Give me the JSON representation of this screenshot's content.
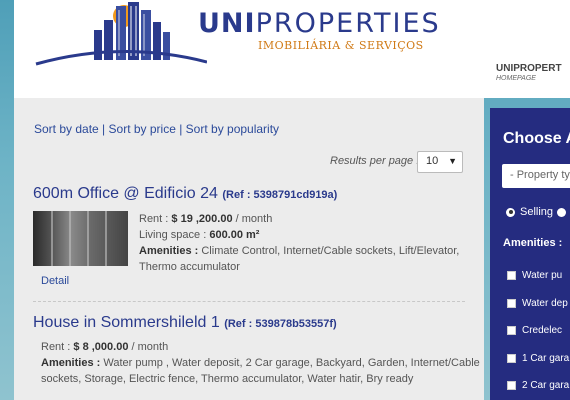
{
  "brand": {
    "name_bold": "UNI",
    "name_light": "PROPERTIES",
    "tagline": "IMOBILIÁRIA & SERVIÇOS",
    "colors": {
      "primary": "#2a3a8c",
      "accent": "#d07a16",
      "sun": "#f29a1d"
    }
  },
  "top_nav": {
    "label": "UNIPROPERT",
    "sublabel": "HOMEPAGE"
  },
  "sort": {
    "by_date": "Sort by date",
    "sep1": " | ",
    "by_price": "Sort by price",
    "sep2": " | ",
    "by_popularity": "Sort by popularity"
  },
  "results_per_page": {
    "label": "Results per page :",
    "value": "10"
  },
  "listings": [
    {
      "title": "600m Office @ Edificio 24 ",
      "ref_label": "(Ref : 5398791cd919a)",
      "rent_label": "Rent : ",
      "rent_value": "$ 19 ,200.00",
      "rent_unit": " / month",
      "space_label": "Living space : ",
      "space_value": "600.00 m²",
      "amenities_label": "Amenities : ",
      "amenities": "Climate Control, Internet/Cable sockets, Lift/Elevator, Thermo accumulator",
      "detail_link": "Detail"
    },
    {
      "title": "House in Sommershileld 1 ",
      "ref_label": "(Ref : 539878b53557f)",
      "rent_label": "Rent : ",
      "rent_value": "$ 8 ,000.00",
      "rent_unit": " / month",
      "amenities_label": "Amenities : ",
      "amenities": "Water pump , Water deposit, 2 Car garage, Backyard, Garden, Internet/Cable sockets, Storage, Electric fence, Thermo accumulator, Water hatir, Bry ready"
    }
  ],
  "filter": {
    "title": "Choose A",
    "property_type_placeholder": "- Property ty",
    "mode_selected": "Selling",
    "amenities_label": "Amenities :",
    "amenities": [
      "Water pu",
      "Water dep",
      "Credelec",
      "1 Car gara",
      "2 Car gara"
    ]
  },
  "icons": [
    "logo-skyline-icon",
    "chevron-down-icon",
    "radio-icon",
    "checkbox-icon"
  ]
}
